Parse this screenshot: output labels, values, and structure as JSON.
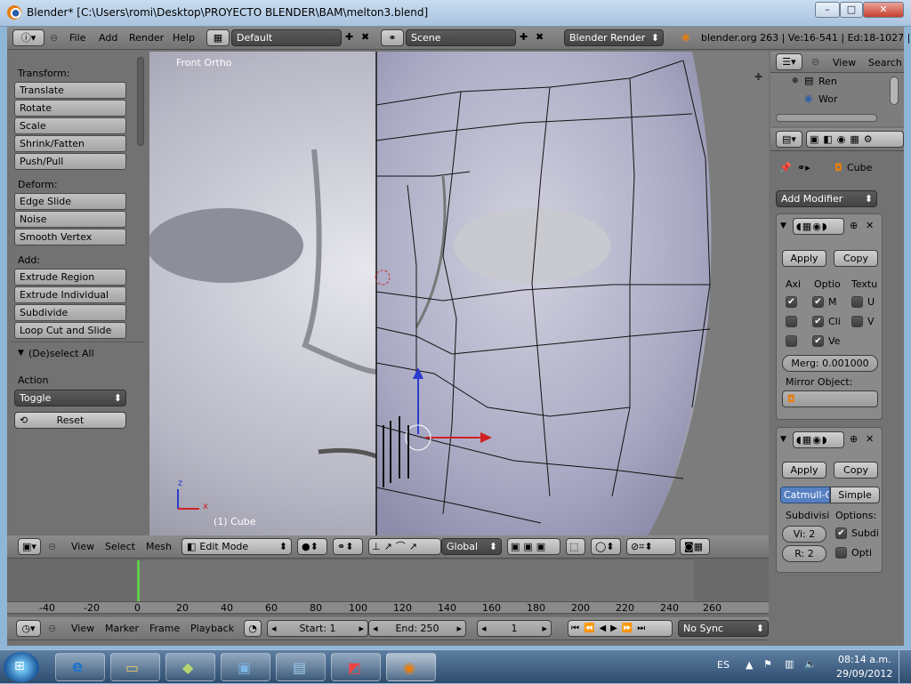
{
  "window": {
    "title": "Blender* [C:\\Users\\romi\\Desktop\\PROYECTO BLENDER\\BAM\\melton3.blend]",
    "min": "–",
    "max": "□",
    "close": "✕"
  },
  "info_header": {
    "menus": [
      "File",
      "Add",
      "Render",
      "Help"
    ],
    "screen_layout": "Default",
    "scene": "Scene",
    "engine": "Blender Render",
    "stats": "blender.org 263 | Ve:16-541 | Ed:18-1027 | F"
  },
  "toolshelf": {
    "transform_heading": "Transform:",
    "transform": [
      "Translate",
      "Rotate",
      "Scale",
      "Shrink/Fatten",
      "Push/Pull"
    ],
    "deform_heading": "Deform:",
    "deform": [
      "Edge Slide",
      "Noise",
      "Smooth Vertex"
    ],
    "add_heading": "Add:",
    "add": [
      "Extrude Region",
      "Extrude Individual",
      "Subdivide",
      "Loop Cut and Slide"
    ],
    "operator_title": "(De)select All",
    "action_label": "Action",
    "action_value": "Toggle",
    "reset_label": "Reset"
  },
  "viewport": {
    "view_name": "Front Ortho",
    "object_info": "(1) Cube",
    "axis_z": "z",
    "axis_x": "x"
  },
  "view3d_header": {
    "menus": [
      "View",
      "Select",
      "Mesh"
    ],
    "mode": "Edit Mode",
    "orientation": "Global"
  },
  "timeline": {
    "ticks": [
      "-40",
      "-20",
      "0",
      "20",
      "40",
      "60",
      "80",
      "100",
      "120",
      "140",
      "160",
      "180",
      "200",
      "220",
      "240",
      "260"
    ],
    "menus": [
      "View",
      "Marker",
      "Frame",
      "Playback"
    ],
    "start": "Start: 1",
    "end": "End: 250",
    "current": "1",
    "sync": "No Sync"
  },
  "outliner": {
    "menus": [
      "View",
      "Search"
    ],
    "items": [
      "Ren",
      "Wor"
    ]
  },
  "properties": {
    "object_name": "Cube",
    "add_modifier": "Add Modifier",
    "mirror": {
      "apply": "Apply",
      "copy": "Copy",
      "col_axis": "Axi",
      "col_options": "Optio",
      "col_texture": "Textu",
      "opt_m": "M",
      "opt_cli": "Cli",
      "opt_ve": "Ve",
      "tex_u": "U",
      "tex_v": "V",
      "merge": "Merg: 0.001000",
      "mirror_object": "Mirror Object:",
      "axis_checked": [
        true,
        false,
        false
      ],
      "options_checked": [
        true,
        true,
        true
      ],
      "tex_checked": [
        false,
        false
      ]
    },
    "subsurf": {
      "apply": "Apply",
      "copy": "Copy",
      "type_catmull": "Catmull-Cl",
      "type_simple": "Simple",
      "subdiv_label": "Subdivisi",
      "options_label": "Options:",
      "view": "Vi: 2",
      "render": "R: 2",
      "opt_subdiv": "Subdi",
      "opt_optimal": "Opti",
      "opt_subdiv_checked": true,
      "opt_optimal_checked": false
    }
  },
  "taskbar": {
    "lang": "ES",
    "time": "08:14 a.m.",
    "date": "29/09/2012"
  },
  "colors": {
    "accent_blue": "#5680c2",
    "keyframe_green": "#5fc94a",
    "header_gray": "#747474"
  }
}
